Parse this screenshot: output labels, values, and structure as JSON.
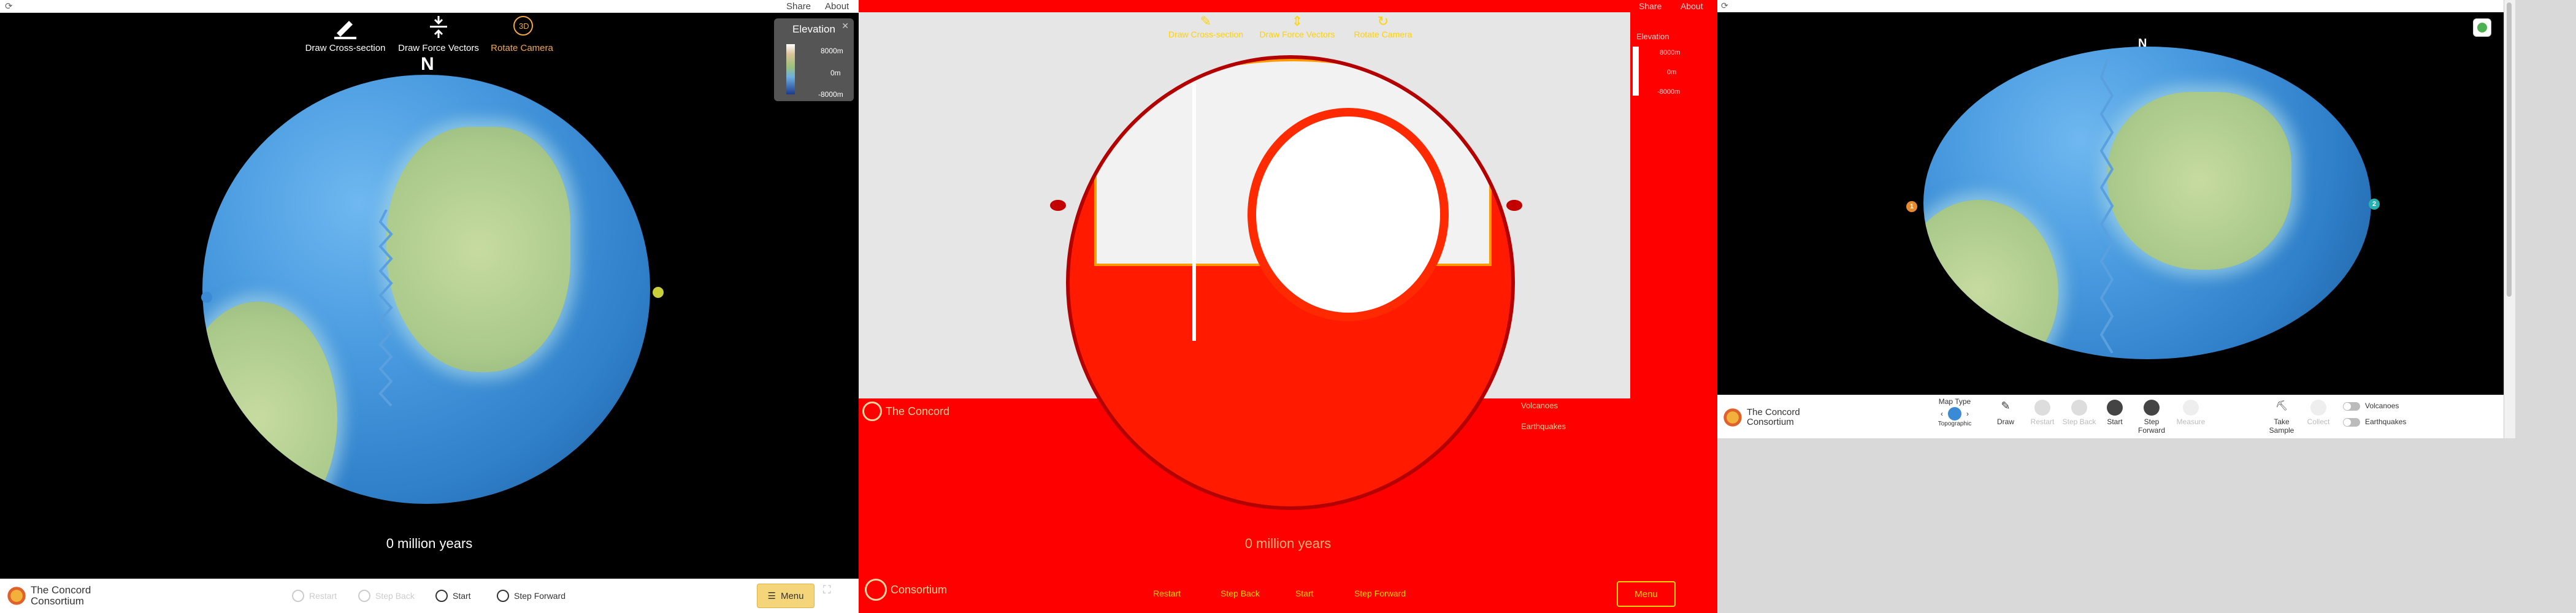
{
  "panel_left": {
    "header": {
      "share": "Share",
      "about": "About"
    },
    "tools": [
      {
        "label": "Draw Cross-section",
        "icon": "pencil-icon",
        "active": false
      },
      {
        "label": "Draw Force Vectors",
        "icon": "force-arrows-icon",
        "active": false
      },
      {
        "label": "Rotate Camera",
        "icon": "rotate-3d-icon",
        "active": true,
        "badge": "3D"
      }
    ],
    "north": "N",
    "legend": {
      "title": "Elevation",
      "max": "8000m",
      "mid": "0m",
      "min": "-8000m"
    },
    "time": "0 million years",
    "logo": {
      "line1": "The Concord",
      "line2": "Consortium"
    },
    "controls": {
      "restart": "Restart",
      "step_back": "Step Back",
      "start": "Start",
      "step_forward": "Step Forward"
    },
    "menu": "Menu",
    "colors": {
      "accent": "#f3a845",
      "ocean": "#3a8ad6",
      "land": "#a9c98a"
    }
  },
  "panel_middle": {
    "header": {
      "share": "Share",
      "about": "About"
    },
    "tools": [
      {
        "label": "Draw Cross-section"
      },
      {
        "label": "Draw Force Vectors"
      },
      {
        "label": "Rotate Camera"
      }
    ],
    "legend": {
      "title": "Elevation",
      "max": "8000m",
      "mid": "0m",
      "min": "-8000m"
    },
    "time": "0 million years",
    "logo": {
      "line1": "The Concord",
      "line2": "Consortium"
    },
    "controls": {
      "restart": "Restart",
      "step_back": "Step Back",
      "start": "Start",
      "step_forward": "Step Forward"
    },
    "menu": "Menu",
    "toggles": {
      "volcanoes": "Volcanoes",
      "earthquakes": "Earthquakes"
    }
  },
  "panel_right": {
    "north": "N",
    "markers": {
      "left": "1",
      "right": "2"
    },
    "logo": {
      "line1": "The Concord",
      "line2": "Consortium"
    },
    "map_type": {
      "label": "Map Type",
      "value": "Topographic"
    },
    "tools": [
      {
        "label": "Draw",
        "dim": false
      },
      {
        "label": "Restart",
        "dim": true
      },
      {
        "label": "Step Back",
        "dim": true
      },
      {
        "label": "Start",
        "dim": false
      },
      {
        "label": "Step Forward",
        "dim": false
      },
      {
        "label": "Measure",
        "dim": true
      },
      {
        "label": "Take Sample",
        "dim": false
      },
      {
        "label": "Collect",
        "dim": true
      }
    ],
    "toggles": {
      "volcanoes": "Volcanoes",
      "earthquakes": "Earthquakes"
    }
  }
}
